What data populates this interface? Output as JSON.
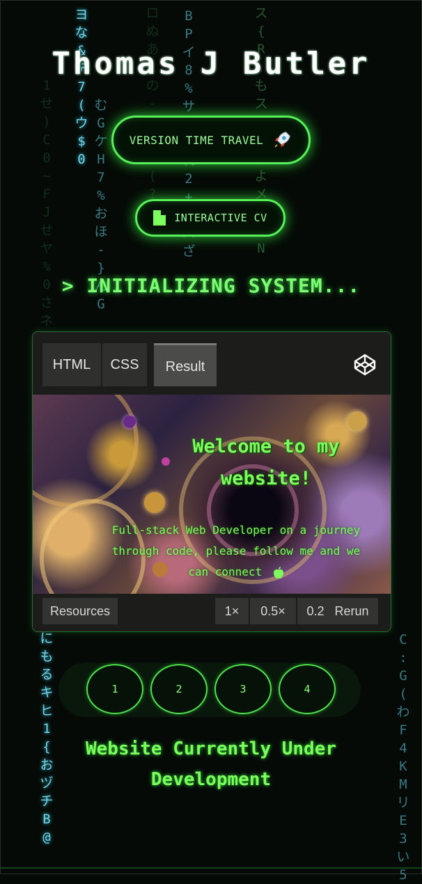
{
  "header": {
    "title": "Thomas J Butler"
  },
  "buttons": {
    "time_travel": {
      "label": "VERSION TIME TRAVEL",
      "icon": "rocket-icon"
    },
    "cv": {
      "label": "INTERACTIVE CV",
      "icon": "document-icon"
    }
  },
  "status": {
    "text": "> INITIALIZING SYSTEM..."
  },
  "codepen": {
    "tabs": [
      "HTML",
      "CSS",
      "Result"
    ],
    "active_tab": "Result",
    "logo_icon": "codepen-icon",
    "welcome": "Welcome to my website!",
    "subtitle": "Full-stack Web Developer on a journey through code, please follow me and we can connect",
    "footer": {
      "resources": "Resources",
      "zoom_1": "1×",
      "zoom_05": "0.5×",
      "zoom_02": "0.2",
      "rerun": "Rerun"
    }
  },
  "pager": {
    "pages": [
      "1",
      "2",
      "3",
      "4"
    ]
  },
  "notice": {
    "text": "Website Currently Under Development"
  },
  "matrix_columns": {
    "c1": "ヨな&デ7(ウ$0",
    "c2": "むGケH7%おほ-}んG",
    "c3": "BPイ8%サグられ2+ラハざ",
    "c4": "にもるキヒ1{おヅチB@",
    "c5": "C:G(わF4KMリE3い5",
    "c6": "ロぬあ1の-<Aオ(?6$",
    "c7": "ス{R.もス}>]よメネてN",
    "c8": "1せ)C0~FJせヤ%0さネ"
  },
  "colors": {
    "accent": "#58f05a",
    "text_green": "#7cff5c",
    "background": "#050a06",
    "cyan": "#6fd5e8"
  }
}
